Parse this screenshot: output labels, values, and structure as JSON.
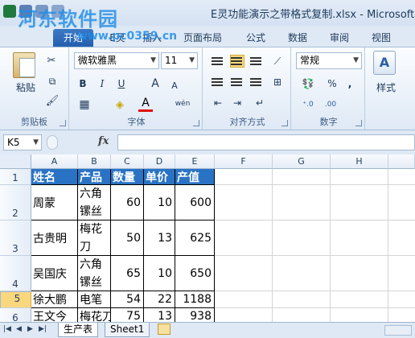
{
  "window": {
    "title": "E灵功能演示之带格式复制.xlsx - Microsoft"
  },
  "watermark": {
    "text": "河东软件园",
    "url": "www.pc0359.cn"
  },
  "tabs": [
    {
      "label": "开始"
    },
    {
      "label": "E灵"
    },
    {
      "label": "插入"
    },
    {
      "label": "页面布局"
    },
    {
      "label": "公式"
    },
    {
      "label": "数据"
    },
    {
      "label": "审阅"
    },
    {
      "label": "视图"
    }
  ],
  "ribbon": {
    "clipboard": {
      "label": "剪贴板",
      "paste": "粘贴"
    },
    "font": {
      "label": "字体",
      "name": "微软雅黑",
      "size": "11",
      "bold": "B",
      "italic": "I",
      "underline": "U",
      "grow": "A",
      "shrink": "A",
      "font_color": "A",
      "wen": "wén"
    },
    "alignment": {
      "label": "对齐方式"
    },
    "number": {
      "label": "数字",
      "format": "常规",
      "percent": "%",
      "comma": ","
    },
    "styles": {
      "label": "样式"
    }
  },
  "formula_bar": {
    "name_box": "K5",
    "fx": "fx",
    "value": ""
  },
  "columns": [
    "A",
    "B",
    "C",
    "D",
    "E",
    "F",
    "G",
    "H"
  ],
  "rows": [
    "1",
    "2",
    "3",
    "4",
    "5",
    "6"
  ],
  "selected_row": "5",
  "table": {
    "headers": [
      "姓名",
      "产品",
      "数量",
      "单价",
      "产值"
    ],
    "data": [
      [
        "周蒙",
        "六角镙丝",
        "60",
        "10",
        "600"
      ],
      [
        "古贵明",
        "梅花刀",
        "50",
        "13",
        "625"
      ],
      [
        "吴国庆",
        "六角镙丝",
        "65",
        "10",
        "650"
      ],
      [
        "徐大鹏",
        "电笔",
        "54",
        "22",
        "1188"
      ],
      [
        "王文今",
        "梅花刀",
        "75",
        "13",
        "938"
      ]
    ]
  },
  "sheet_tabs": [
    {
      "label": "生产表"
    },
    {
      "label": "Sheet1"
    }
  ],
  "colors": {
    "header_fill": "#2a73c4",
    "file_tab": "#2f6db9",
    "selected_row": "#f8d77e"
  }
}
